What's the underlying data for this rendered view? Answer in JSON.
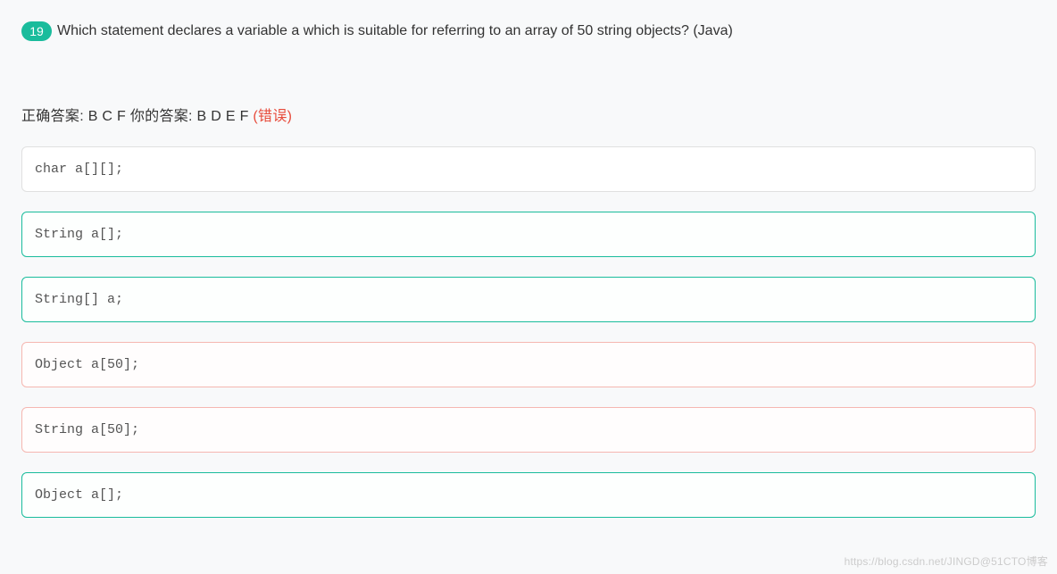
{
  "question": {
    "number": "19",
    "text": "Which statement declares a variable a which is suitable for referring to an array of 50 string objects?  (Java)"
  },
  "answers": {
    "correct_label": "正确答案: ",
    "correct_value": "B C F",
    "your_label": "   你的答案: ",
    "your_value": "B D E F ",
    "wrong_tag": "(错误)"
  },
  "options": [
    {
      "code": "char a[][];",
      "state": "neutral"
    },
    {
      "code": "String a[];",
      "state": "correct"
    },
    {
      "code": "String[] a;",
      "state": "correct"
    },
    {
      "code": "Object a[50];",
      "state": "wrong"
    },
    {
      "code": "String a[50];",
      "state": "wrong"
    },
    {
      "code": "Object a[];",
      "state": "correct-partial"
    }
  ],
  "watermark": "https://blog.csdn.net/JINGD@51CTO博客"
}
